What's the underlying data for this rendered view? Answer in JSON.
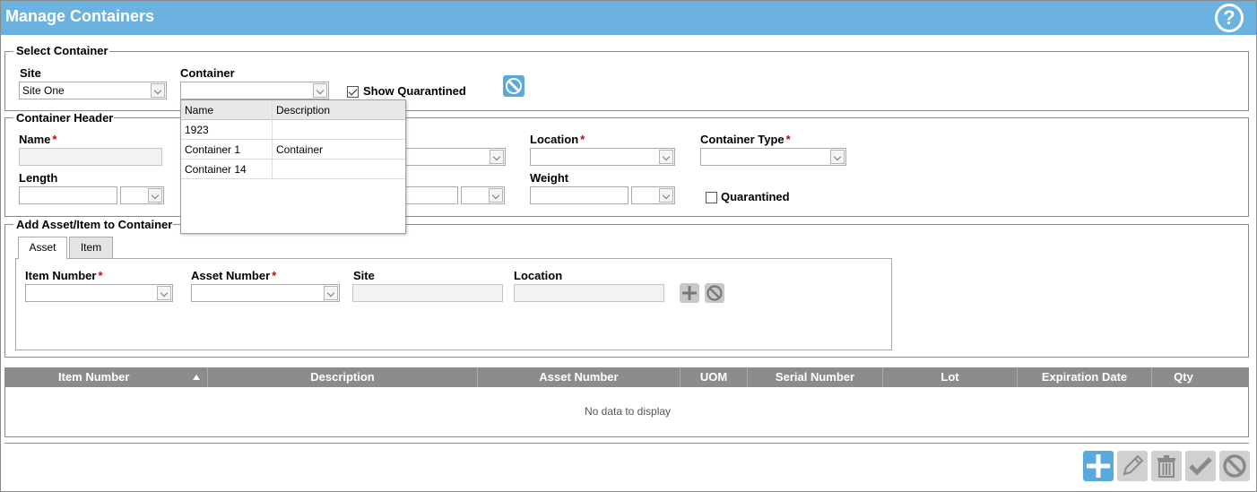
{
  "window": {
    "title": "Manage Containers",
    "help_symbol": "?"
  },
  "select_container": {
    "legend": "Select Container",
    "site_label": "Site",
    "site_value": "Site One",
    "container_label": "Container",
    "container_value": "",
    "show_quarantined_label": "Show Quarantined",
    "show_quarantined_checked": true
  },
  "container_dropdown": {
    "columns": [
      "Name",
      "Description"
    ],
    "rows": [
      {
        "name": "1923",
        "description": ""
      },
      {
        "name": "Container 1",
        "description": "Container"
      },
      {
        "name": "Container 14",
        "description": ""
      }
    ]
  },
  "container_header": {
    "legend": "Container Header",
    "name_label": "Name",
    "length_label": "Length",
    "location_label": "Location",
    "container_type_label": "Container Type",
    "weight_label": "Weight",
    "quarantined_label": "Quarantined",
    "required_mark": "*"
  },
  "add_asset": {
    "legend": "Add Asset/Item to Container",
    "tabs": [
      "Asset",
      "Item"
    ],
    "active_tab": "Asset",
    "item_number_label": "Item Number",
    "asset_number_label": "Asset Number",
    "site_label": "Site",
    "location_label": "Location"
  },
  "grid": {
    "columns": [
      "Item Number",
      "Description",
      "Asset Number",
      "UOM",
      "Serial Number",
      "Lot",
      "Expiration Date",
      "Qty"
    ],
    "empty_text": "No data to display"
  },
  "colors": {
    "title_bar": "#6cb2e1",
    "primary_button": "#5aa9dd",
    "disabled_button": "#c8c8c8",
    "grid_header": "#8c8c8c",
    "required": "#d40000"
  },
  "icons": [
    "help-icon",
    "clear-selection-icon",
    "add-icon",
    "clear-icon",
    "edit-icon",
    "delete-icon",
    "save-icon",
    "cancel-icon"
  ]
}
